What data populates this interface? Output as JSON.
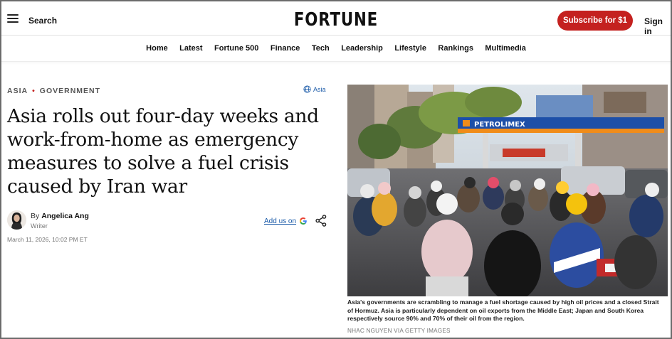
{
  "header": {
    "search_label": "Search",
    "logo": "FORTUNE",
    "subscribe_label": "Subscribe for $1",
    "signin_label": "Sign in"
  },
  "nav": {
    "items": [
      "Home",
      "Latest",
      "Fortune 500",
      "Finance",
      "Tech",
      "Leadership",
      "Lifestyle",
      "Rankings",
      "Multimedia"
    ]
  },
  "article": {
    "category_primary": "ASIA",
    "category_secondary": "GOVERNMENT",
    "region_badge": "Asia",
    "headline": "Asia rolls out four-day weeks and work-from-home as emergency measures to solve a fuel crisis caused by Iran war",
    "byline_prefix": "By",
    "author": "Angelica Ang",
    "author_role": "Writer",
    "add_us_label": "Add us on",
    "date": "March 11, 2026, 10:02 PM ET"
  },
  "photo": {
    "sign_text": "PETROLIMEX",
    "caption": "Asia's governments are scrambling to manage a fuel shortage caused by high oil prices and a closed Strait of Hormuz. Asia is particularly dependent on oil exports from the Middle East; Japan and South Korea respectively source 90% and 70% of their oil from the region.",
    "credit": "NHAC NGUYEN VIA GETTY IMAGES"
  },
  "colors": {
    "brand_red": "#c4211f",
    "link_blue": "#1a5aa8"
  }
}
